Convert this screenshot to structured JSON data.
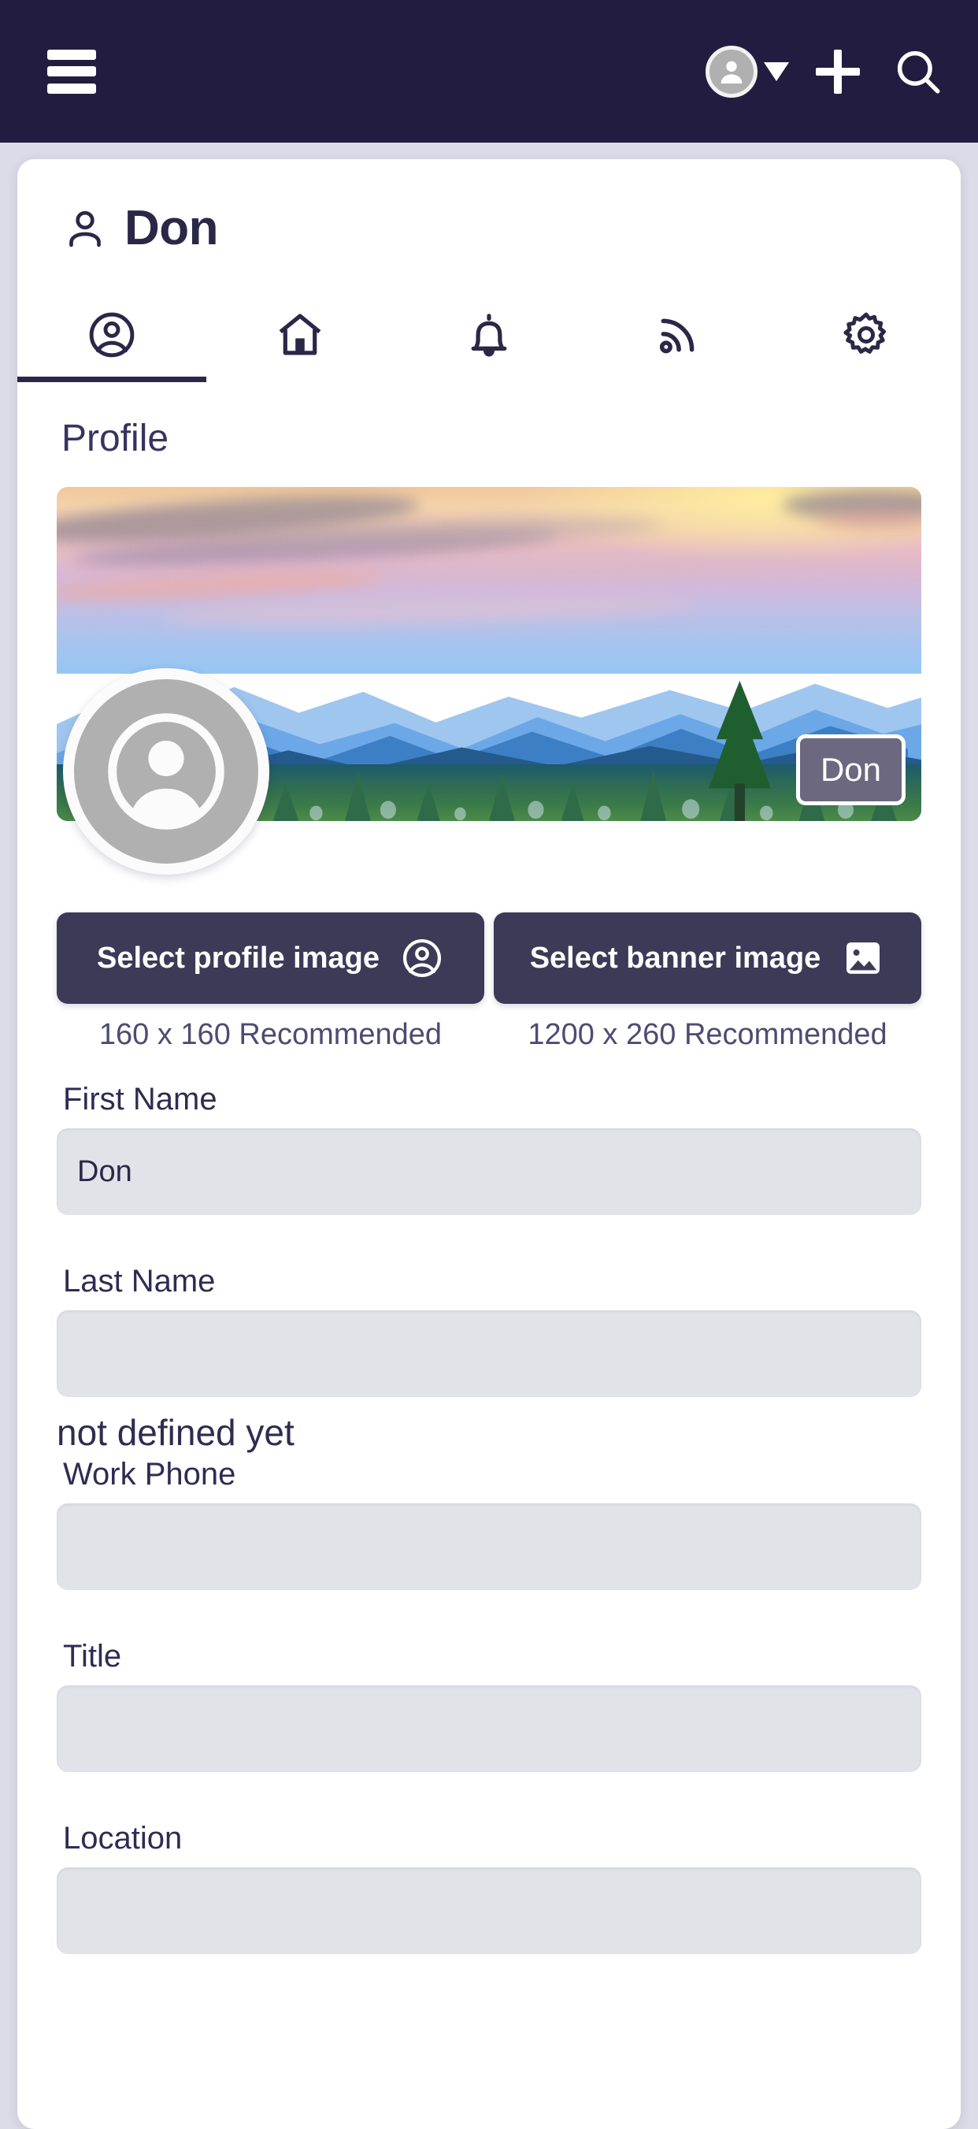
{
  "theme": {
    "topbar_bg": "#221d40",
    "page_bg": "#dcdce8",
    "card_bg": "#ffffff",
    "accent_dark": "#3c3a57",
    "text_dark": "#2b2747",
    "input_bg": "#e2e3e9",
    "badge_bg": "#6b6880"
  },
  "topbar": {
    "menu_icon": "hamburger-menu-icon",
    "avatar_icon": "user-avatar-icon",
    "dropdown_icon": "chevron-down-icon",
    "add_icon": "plus-icon",
    "search_icon": "search-icon"
  },
  "header": {
    "icon": "user-icon",
    "title": "Don"
  },
  "tabs": [
    {
      "name": "profile",
      "icon": "user-circle-icon",
      "active": true
    },
    {
      "name": "home",
      "icon": "home-icon",
      "active": false
    },
    {
      "name": "notifications",
      "icon": "bell-icon",
      "active": false
    },
    {
      "name": "feed",
      "icon": "rss-icon",
      "active": false
    },
    {
      "name": "settings",
      "icon": "gear-icon",
      "active": false
    }
  ],
  "section": {
    "title": "Profile"
  },
  "banner": {
    "alt": "mountain-sunset-landscape",
    "badge_label": "Don",
    "avatar_icon": "user-avatar-placeholder-icon"
  },
  "image_buttons": [
    {
      "label": "Select profile image",
      "icon": "user-circle-icon",
      "hint": "160 x 160 Recommended"
    },
    {
      "label": "Select banner image",
      "icon": "picture-icon",
      "hint": "1200 x 260 Recommended"
    }
  ],
  "form": {
    "fields": [
      {
        "label": "First Name",
        "value": "Don",
        "placeholder": ""
      },
      {
        "label": "Last Name",
        "value": "",
        "placeholder": ""
      },
      {
        "label": "Work Phone",
        "value": "",
        "placeholder": ""
      },
      {
        "label": "Title",
        "value": "",
        "placeholder": ""
      },
      {
        "label": "Location",
        "value": "",
        "placeholder": ""
      }
    ],
    "note": "not defined yet"
  }
}
